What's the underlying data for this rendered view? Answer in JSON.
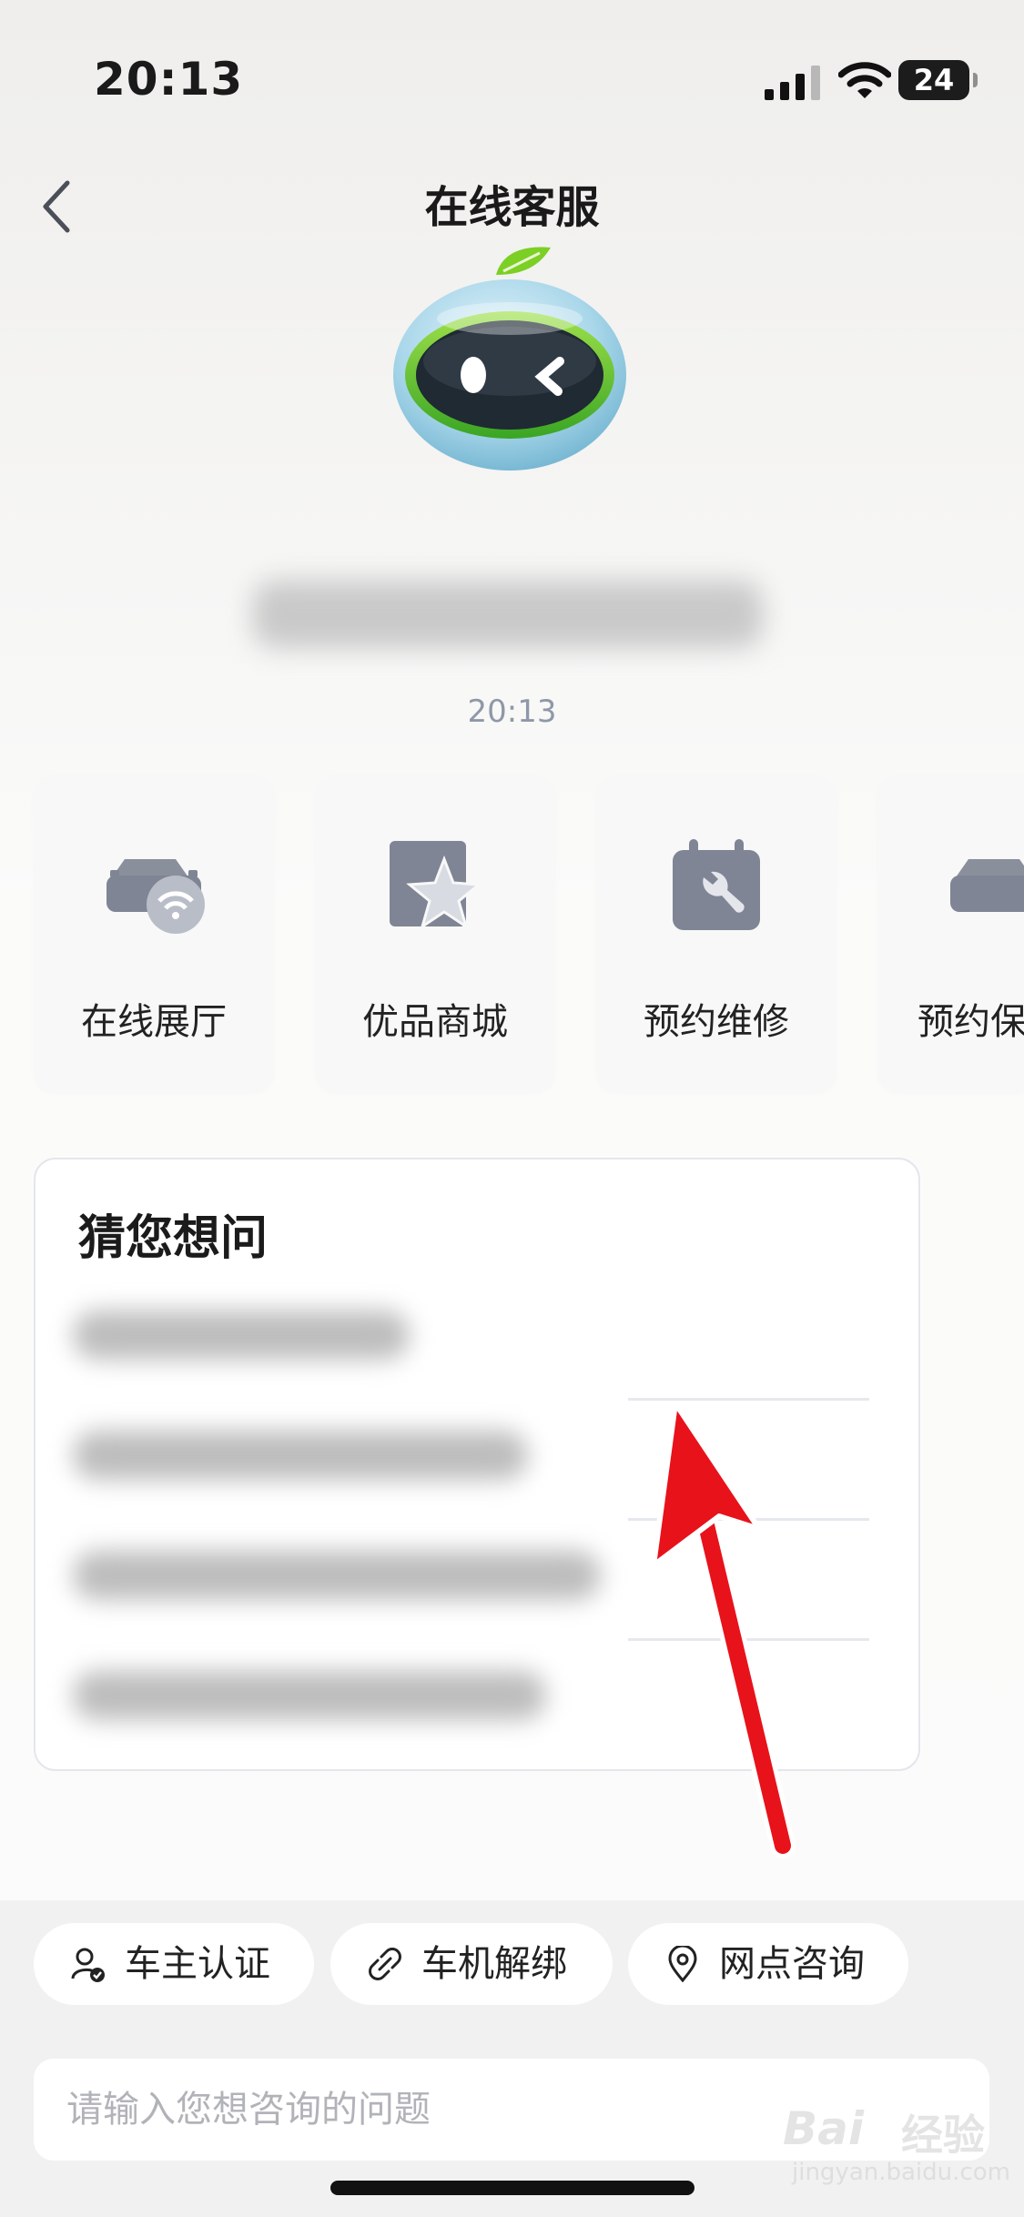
{
  "status_bar": {
    "time": "20:13",
    "battery": "24"
  },
  "nav": {
    "title": "在线客服"
  },
  "message": {
    "timestamp": "20:13"
  },
  "services": [
    {
      "label": "在线展厅",
      "icon": "car-wifi-icon"
    },
    {
      "label": "优品商城",
      "icon": "star-card-icon"
    },
    {
      "label": "预约维修",
      "icon": "calendar-wrench-icon"
    },
    {
      "label": "预约保",
      "icon": "car-icon"
    }
  ],
  "guess_panel": {
    "title": "猜您想问"
  },
  "quick_actions": [
    {
      "label": "车主认证",
      "icon": "user-verified-icon"
    },
    {
      "label": "车机解绑",
      "icon": "unlink-icon"
    },
    {
      "label": "网点咨询",
      "icon": "location-pin-icon"
    }
  ],
  "input": {
    "placeholder": "请输入您想咨询的问题"
  },
  "watermark": {
    "brand": "Bai",
    "text": "经验",
    "domain": "jingyan.baidu.com"
  },
  "colors": {
    "accent_red": "#e8121a",
    "icon_gray": "#7f8594",
    "leaf_green": "#6fc21f"
  }
}
